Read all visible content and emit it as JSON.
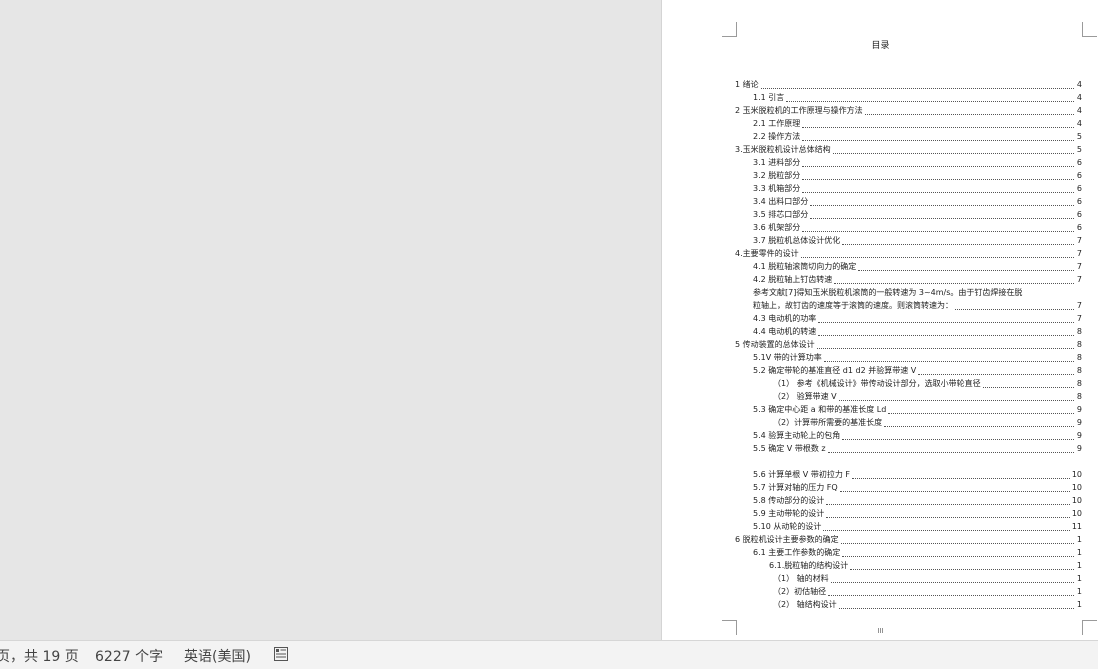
{
  "document": {
    "toc_title": "目录",
    "page_number": "III",
    "entries": [
      {
        "text": "1 绪论",
        "page": "4",
        "level": 0
      },
      {
        "text": "1.1 引言",
        "page": "4",
        "level": 1
      },
      {
        "text": "2 玉米脱粒机的工作原理与操作方法",
        "page": "4",
        "level": 0
      },
      {
        "text": "2.1   工作原理",
        "page": "4",
        "level": 1
      },
      {
        "text": "2.2    操作方法",
        "page": "5",
        "level": 1
      },
      {
        "text": "3.玉米脱粒机设计总体结构",
        "page": "5",
        "level": 0
      },
      {
        "text": "3.1 进料部分",
        "page": "6",
        "level": 1
      },
      {
        "text": "3.2 脱粒部分",
        "page": "6",
        "level": 1
      },
      {
        "text": "3.3 机箱部分",
        "page": "6",
        "level": 1
      },
      {
        "text": "3.4 出料口部分",
        "page": "6",
        "level": 1
      },
      {
        "text": "3.5 排芯口部分",
        "page": "6",
        "level": 1
      },
      {
        "text": "3.6 机架部分",
        "page": "6",
        "level": 1
      },
      {
        "text": "3.7 脱粒机总体设计优化",
        "page": "7",
        "level": 1
      },
      {
        "text": "4.主要零件的设计",
        "page": "7",
        "level": 0
      },
      {
        "text": "4.1 脱粒轴滚筒切向力的确定",
        "page": "7",
        "level": 1
      },
      {
        "text": "4.2 脱粒轴上钉齿转速",
        "page": "7",
        "level": 1
      },
      {
        "text": "参考文献[7]得知玉米脱粒机滚筒的一般转速为 3~4m/s。由于钉齿焊接在脱",
        "page": "",
        "level": 1,
        "plain": true
      },
      {
        "text": "粒轴上，故钉齿的速度等于滚筒的速度。则滚筒转速为：",
        "page": "7",
        "level": 1
      },
      {
        "text": "4.3 电动机的功率",
        "page": "7",
        "level": 1
      },
      {
        "text": "4.4 电动机的转速",
        "page": "8",
        "level": 1
      },
      {
        "text": "5 传动装置的总体设计",
        "page": "8",
        "level": 0
      },
      {
        "text": "5.1V 带的计算功率",
        "page": "8",
        "level": 1
      },
      {
        "text": "5.2 确定带轮的基准直径 d1 d2 并验算带速 V",
        "page": "8",
        "level": 1
      },
      {
        "text": "（1）  参考《机械设计》带传动设计部分，选取小带轮直径",
        "page": "8",
        "level": 2
      },
      {
        "text": "（2）  验算带速 V",
        "page": "8",
        "level": 2
      },
      {
        "text": "5.3 确定中心距 a 和带的基准长度 Ld",
        "page": "9",
        "level": 1
      },
      {
        "text": "（2）计算带所需要的基准长度",
        "page": "9",
        "level": 2
      },
      {
        "text": "5.4 验算主动轮上的包角",
        "page": "9",
        "level": 1
      },
      {
        "text": "5.5 确定 V 带根数 z",
        "page": "9",
        "level": 1
      },
      {
        "text": "",
        "page": "",
        "level": 1,
        "gap": true
      },
      {
        "text": "5.6 计算单根 V 带初拉力 F",
        "page": "10",
        "level": 1
      },
      {
        "text": "5.7 计算对轴的压力 FQ",
        "page": "10",
        "level": 1
      },
      {
        "text": "5.8 传动部分的设计",
        "page": "10",
        "level": 1
      },
      {
        "text": "5.9 主动带轮的设计",
        "page": "10",
        "level": 1
      },
      {
        "text": "5.10 从动轮的设计",
        "page": "11",
        "level": 1
      },
      {
        "text": "6 脱粒机设计主要参数的确定",
        "page": "1",
        "level": 0
      },
      {
        "text": "6.1 主要工作参数的确定",
        "page": "1",
        "level": 1
      },
      {
        "text": "6.1.脱粒轴的结构设计",
        "page": "1",
        "level": 3
      },
      {
        "text": "（1）  轴的材料",
        "page": "1",
        "level": 2
      },
      {
        "text": "（2）初估轴径",
        "page": "1",
        "level": 2
      },
      {
        "text": "（2）  轴结构设计",
        "page": "1",
        "level": 2
      }
    ]
  },
  "statusbar": {
    "page_info": "页，共 19 页",
    "word_count": "6227 个字",
    "language": "英语(美国)",
    "icon": "document-layout-icon"
  }
}
